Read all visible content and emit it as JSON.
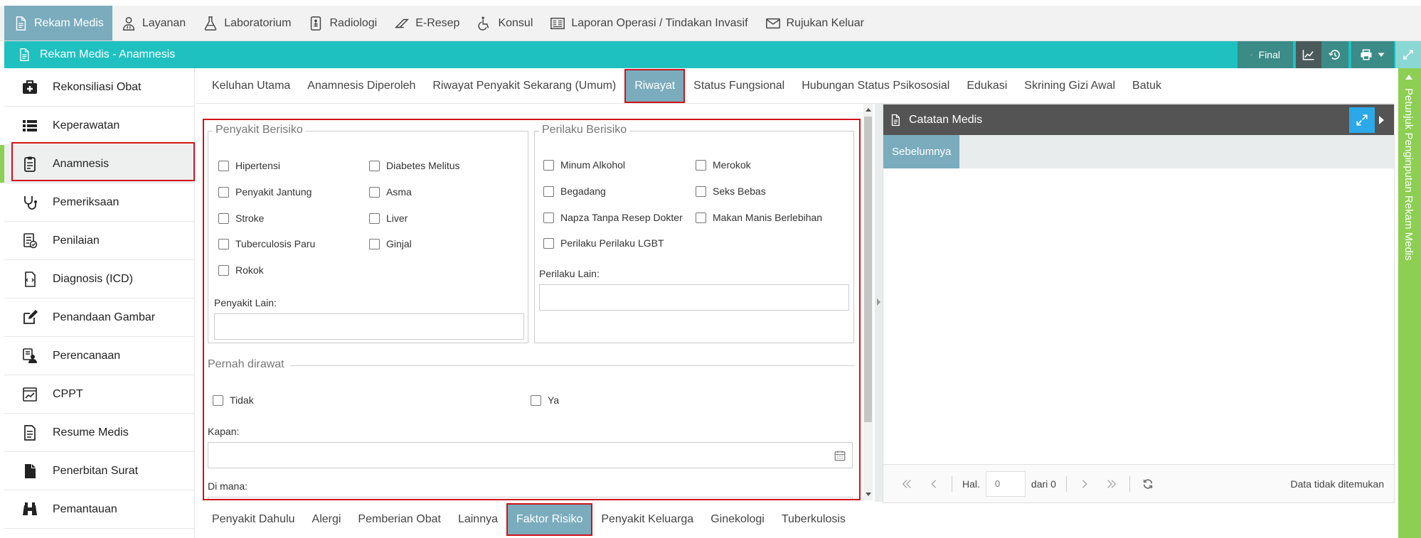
{
  "topnav": [
    {
      "label": "Rekam Medis",
      "icon": "document-icon",
      "active": true
    },
    {
      "label": "Layanan",
      "icon": "doctor-icon"
    },
    {
      "label": "Laboratorium",
      "icon": "flask-icon"
    },
    {
      "label": "Radiologi",
      "icon": "xray-icon"
    },
    {
      "label": "E-Resep",
      "icon": "pill-icon"
    },
    {
      "label": "Konsul",
      "icon": "wheelchair-icon"
    },
    {
      "label": "Laporan Operasi / Tindakan Invasif",
      "icon": "report-icon"
    },
    {
      "label": "Rujukan Keluar",
      "icon": "envelope-icon"
    }
  ],
  "titlebar": {
    "title": "Rekam Medis - Anamnesis",
    "final_label": "Final"
  },
  "sidebar": [
    {
      "label": "Rekonsiliasi Obat",
      "icon": "medkit-icon"
    },
    {
      "label": "Keperawatan",
      "icon": "list-icon"
    },
    {
      "label": "Anamnesis",
      "icon": "clipboard-icon",
      "active": true
    },
    {
      "label": "Pemeriksaan",
      "icon": "stethoscope-icon"
    },
    {
      "label": "Penilaian",
      "icon": "checklist-icon"
    },
    {
      "label": "Diagnosis (ICD)",
      "icon": "file-code-icon"
    },
    {
      "label": "Penandaan Gambar",
      "icon": "edit-icon"
    },
    {
      "label": "Perencanaan",
      "icon": "user-plan-icon"
    },
    {
      "label": "CPPT",
      "icon": "chart-doc-icon"
    },
    {
      "label": "Resume Medis",
      "icon": "file-text-icon"
    },
    {
      "label": "Penerbitan Surat",
      "icon": "file-icon"
    },
    {
      "label": "Pemantauan",
      "icon": "binoculars-icon"
    }
  ],
  "tabs_top": [
    "Keluhan Utama",
    "Anamnesis Diperoleh",
    "Riwayat Penyakit Sekarang (Umum)",
    "Riwayat",
    "Status Fungsional",
    "Hubungan Status Psikososial",
    "Edukasi",
    "Skrining Gizi Awal",
    "Batuk"
  ],
  "tabs_top_active": "Riwayat",
  "tabs_bottom": [
    "Penyakit Dahulu",
    "Alergi",
    "Pemberian Obat",
    "Lainnya",
    "Faktor Risiko",
    "Penyakit Keluarga",
    "Ginekologi",
    "Tuberkulosis"
  ],
  "tabs_bottom_active": "Faktor Risiko",
  "form": {
    "penyakit": {
      "legend": "Penyakit Berisiko",
      "col1": [
        "Hipertensi",
        "Penyakit Jantung",
        "Stroke",
        "Tuberculosis Paru",
        "Rokok"
      ],
      "col2": [
        "Diabetes Melitus",
        "Asma",
        "Liver",
        "Ginjal"
      ],
      "lain_label": "Penyakit Lain:"
    },
    "perilaku": {
      "legend": "Perilaku Berisiko",
      "col1": [
        "Minum Alkohol",
        "Begadang",
        "Napza Tanpa Resep Dokter",
        "Perilaku Perilaku LGBT"
      ],
      "col2": [
        "Merokok",
        "Seks Bebas",
        "Makan Manis Berlebihan"
      ],
      "lain_label": "Perilaku Lain:"
    },
    "dirawat": {
      "title": "Pernah dirawat",
      "option_no": "Tidak",
      "option_yes": "Ya",
      "kapan_label": "Kapan:",
      "dimana_label": "Di mana:"
    }
  },
  "panel": {
    "title": "Catatan Medis",
    "tab": "Sebelumnya",
    "page_label": "Hal.",
    "page_value": "0",
    "of_label": "dari 0",
    "empty_text": "Data tidak ditemukan"
  },
  "side_guide": "Petunjuk Penginputan Rekam Medis"
}
